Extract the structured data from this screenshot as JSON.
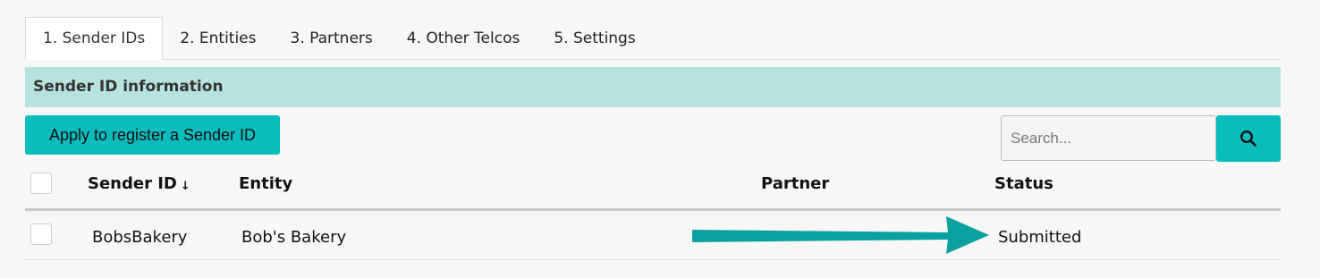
{
  "tabs": [
    {
      "label": "1. Sender IDs",
      "active": true
    },
    {
      "label": "2. Entities",
      "active": false
    },
    {
      "label": "3. Partners",
      "active": false
    },
    {
      "label": "4. Other Telcos",
      "active": false
    },
    {
      "label": "5. Settings",
      "active": false
    }
  ],
  "section": {
    "title": "Sender ID information"
  },
  "toolbar": {
    "apply_label": "Apply to register a Sender ID",
    "search_placeholder": "Search...",
    "search_icon": "search-icon"
  },
  "table": {
    "columns": {
      "sender_id": "Sender ID",
      "sort_indicator": "↓",
      "entity": "Entity",
      "partner": "Partner",
      "status": "Status"
    },
    "rows": [
      {
        "sender_id": "BobsBakery",
        "entity": "Bob's Bakery",
        "partner": "",
        "status": "Submitted"
      }
    ]
  },
  "annotation": {
    "arrow_color": "#0aa0a0",
    "icon": "right-arrow-annotation"
  },
  "colors": {
    "accent": "#0bbcbc",
    "section_header_bg": "#b8e2e0"
  }
}
